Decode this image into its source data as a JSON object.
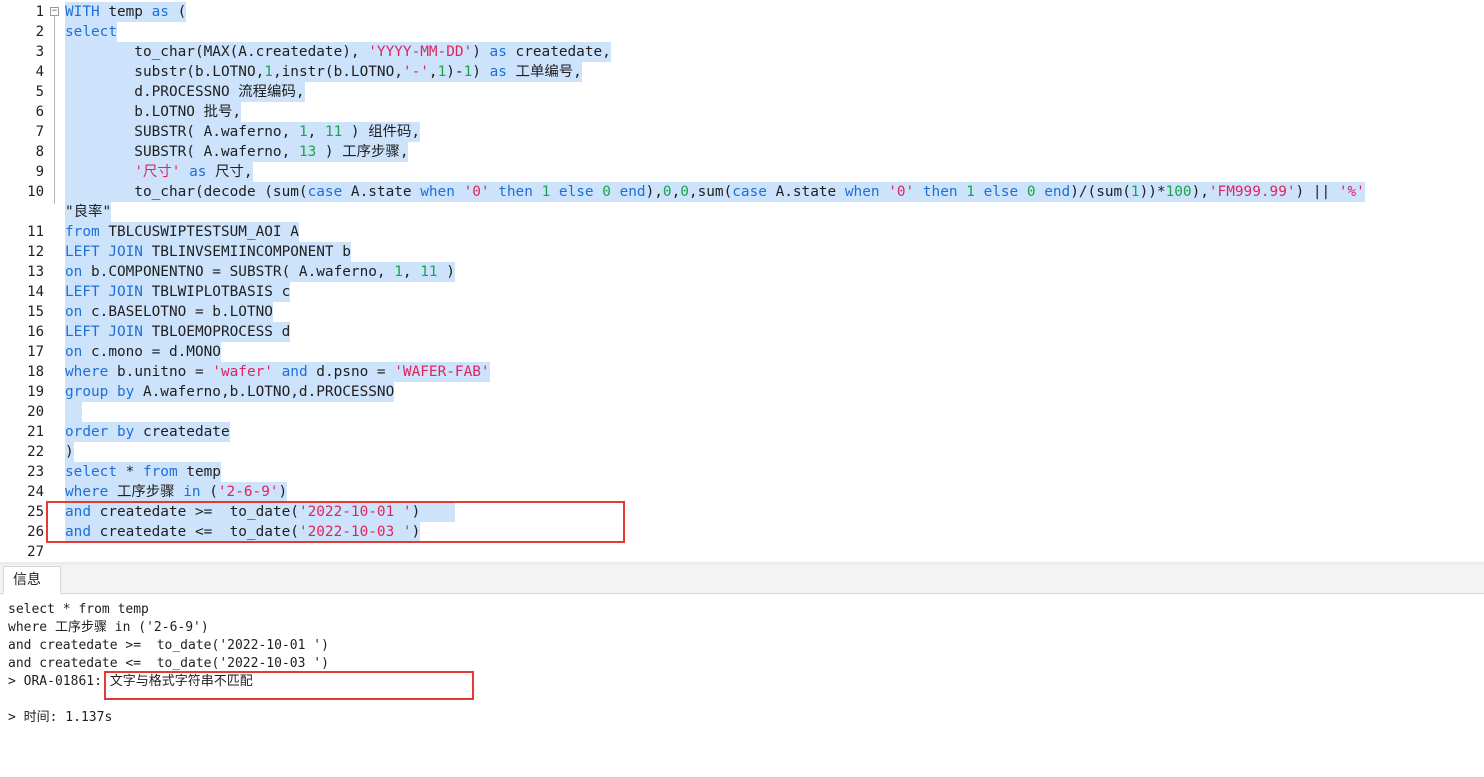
{
  "editor": {
    "lines": [
      {
        "no": "1",
        "parts": [
          [
            "kw",
            "WITH"
          ],
          [
            "t",
            " temp "
          ],
          [
            "kw",
            "as"
          ],
          [
            "t",
            " ("
          ]
        ]
      },
      {
        "no": "2",
        "parts": [
          [
            "kw",
            "select"
          ]
        ]
      },
      {
        "no": "3",
        "parts": [
          [
            "t",
            "        to_char(MAX(A.createdate), "
          ],
          [
            "str",
            "'YYYY-MM-DD'"
          ],
          [
            "t",
            ") "
          ],
          [
            "kw",
            "as"
          ],
          [
            "t",
            " createdate,"
          ]
        ]
      },
      {
        "no": "4",
        "parts": [
          [
            "t",
            "        substr(b.LOTNO,"
          ],
          [
            "num",
            "1"
          ],
          [
            "t",
            ",instr(b.LOTNO,"
          ],
          [
            "str",
            "'-'"
          ],
          [
            "t",
            ","
          ],
          [
            "num",
            "1"
          ],
          [
            "t",
            ")-"
          ],
          [
            "num",
            "1"
          ],
          [
            "t",
            ") "
          ],
          [
            "kw",
            "as"
          ],
          [
            "t",
            " 工单编号,"
          ]
        ]
      },
      {
        "no": "5",
        "parts": [
          [
            "t",
            "        d.PROCESSNO 流程编码,"
          ]
        ]
      },
      {
        "no": "6",
        "parts": [
          [
            "t",
            "        b.LOTNO 批号,"
          ]
        ]
      },
      {
        "no": "7",
        "parts": [
          [
            "t",
            "        SUBSTR( A.waferno, "
          ],
          [
            "num",
            "1"
          ],
          [
            "t",
            ", "
          ],
          [
            "num",
            "11"
          ],
          [
            "t",
            " ) 组件码,"
          ]
        ]
      },
      {
        "no": "8",
        "parts": [
          [
            "t",
            "        SUBSTR( A.waferno, "
          ],
          [
            "num",
            "13"
          ],
          [
            "t",
            " ) 工序步骤,"
          ]
        ]
      },
      {
        "no": "9",
        "parts": [
          [
            "t",
            "        "
          ],
          [
            "str",
            "'尺寸'"
          ],
          [
            "t",
            " "
          ],
          [
            "kw",
            "as"
          ],
          [
            "t",
            " 尺寸,"
          ]
        ]
      },
      {
        "no": "10",
        "parts": [
          [
            "t",
            "        to_char(decode (sum("
          ],
          [
            "kw",
            "case"
          ],
          [
            "t",
            " A.state "
          ],
          [
            "kw",
            "when"
          ],
          [
            "t",
            " "
          ],
          [
            "str",
            "'0'"
          ],
          [
            "t",
            " "
          ],
          [
            "kw",
            "then"
          ],
          [
            "t",
            " "
          ],
          [
            "num",
            "1"
          ],
          [
            "t",
            " "
          ],
          [
            "kw",
            "else"
          ],
          [
            "t",
            " "
          ],
          [
            "num",
            "0"
          ],
          [
            "t",
            " "
          ],
          [
            "kw",
            "end"
          ],
          [
            "t",
            "),"
          ],
          [
            "num",
            "0"
          ],
          [
            "t",
            ","
          ],
          [
            "num",
            "0"
          ],
          [
            "t",
            ",sum("
          ],
          [
            "kw",
            "case"
          ],
          [
            "t",
            " A.state "
          ],
          [
            "kw",
            "when"
          ],
          [
            "t",
            " "
          ],
          [
            "str",
            "'0'"
          ],
          [
            "t",
            " "
          ],
          [
            "kw",
            "then"
          ],
          [
            "t",
            " "
          ],
          [
            "num",
            "1"
          ],
          [
            "t",
            " "
          ],
          [
            "kw",
            "else"
          ],
          [
            "t",
            " "
          ],
          [
            "num",
            "0"
          ],
          [
            "t",
            " "
          ],
          [
            "kw",
            "end"
          ],
          [
            "t",
            ")/(sum("
          ],
          [
            "num",
            "1"
          ],
          [
            "t",
            "))*"
          ],
          [
            "num",
            "100"
          ],
          [
            "t",
            "),"
          ],
          [
            "str",
            "'FM999.99'"
          ],
          [
            "t",
            ") || "
          ],
          [
            "str",
            "'%'"
          ]
        ]
      },
      {
        "no": "",
        "parts": [
          [
            "t",
            "\"良率\""
          ]
        ]
      },
      {
        "no": "11",
        "parts": [
          [
            "kw",
            "from"
          ],
          [
            "t",
            " TBLCUSWIPTESTSUM_AOI A"
          ]
        ]
      },
      {
        "no": "12",
        "parts": [
          [
            "kw",
            "LEFT JOIN"
          ],
          [
            "t",
            " TBLINVSEMIINCOMPONENT b"
          ]
        ]
      },
      {
        "no": "13",
        "parts": [
          [
            "kw",
            "on"
          ],
          [
            "t",
            " b.COMPONENTNO = SUBSTR( A.waferno, "
          ],
          [
            "num",
            "1"
          ],
          [
            "t",
            ", "
          ],
          [
            "num",
            "11"
          ],
          [
            "t",
            " )"
          ]
        ]
      },
      {
        "no": "14",
        "parts": [
          [
            "kw",
            "LEFT JOIN"
          ],
          [
            "t",
            " TBLWIPLOTBASIS c"
          ]
        ]
      },
      {
        "no": "15",
        "parts": [
          [
            "kw",
            "on"
          ],
          [
            "t",
            " c.BASELOTNO = b.LOTNO"
          ]
        ]
      },
      {
        "no": "16",
        "parts": [
          [
            "kw",
            "LEFT JOIN"
          ],
          [
            "t",
            " TBLOEMOPROCESS d"
          ]
        ]
      },
      {
        "no": "17",
        "parts": [
          [
            "kw",
            "on"
          ],
          [
            "t",
            " c.mono = d.MONO"
          ]
        ]
      },
      {
        "no": "18",
        "parts": [
          [
            "kw",
            "where"
          ],
          [
            "t",
            " b.unitno = "
          ],
          [
            "str",
            "'wafer'"
          ],
          [
            "t",
            " "
          ],
          [
            "kw",
            "and"
          ],
          [
            "t",
            " d.psno = "
          ],
          [
            "str",
            "'WAFER-FAB'"
          ]
        ]
      },
      {
        "no": "19",
        "parts": [
          [
            "kw",
            "group by"
          ],
          [
            "t",
            " A.waferno,b.LOTNO,d.PROCESSNO"
          ]
        ]
      },
      {
        "no": "20",
        "parts": [
          [
            "t",
            "  "
          ]
        ]
      },
      {
        "no": "21",
        "parts": [
          [
            "kw",
            "order by"
          ],
          [
            "t",
            " createdate"
          ]
        ]
      },
      {
        "no": "22",
        "parts": [
          [
            "t",
            ")"
          ]
        ]
      },
      {
        "no": "23",
        "parts": [
          [
            "kw",
            "select"
          ],
          [
            "t",
            " * "
          ],
          [
            "kw",
            "from"
          ],
          [
            "t",
            " temp"
          ]
        ]
      },
      {
        "no": "24",
        "parts": [
          [
            "kw",
            "where"
          ],
          [
            "t",
            " 工序步骤 "
          ],
          [
            "kw",
            "in"
          ],
          [
            "t",
            " ("
          ],
          [
            "str",
            "'2-6-9'"
          ],
          [
            "t",
            ")"
          ]
        ]
      },
      {
        "no": "25",
        "parts": [
          [
            "kw",
            "and"
          ],
          [
            "t",
            " createdate >=  to_date("
          ],
          [
            "str",
            "'2022-10-01 '"
          ],
          [
            "t",
            ")    "
          ]
        ]
      },
      {
        "no": "26",
        "parts": [
          [
            "kw",
            "and"
          ],
          [
            "t",
            " createdate <=  to_date("
          ],
          [
            "str",
            "'2022-10-03 '"
          ],
          [
            "t",
            ")"
          ]
        ]
      },
      {
        "no": "27",
        "parts": []
      }
    ]
  },
  "tabs": {
    "info_label": "信息"
  },
  "output": {
    "lines": [
      "select * from temp",
      "where 工序步骤 in ('2-6-9')",
      "and createdate >=  to_date('2022-10-01 ')",
      "and createdate <=  to_date('2022-10-03 ')",
      "> ORA-01861: 文字与格式字符串不匹配",
      "",
      "> 时间: 1.137s"
    ]
  },
  "colors": {
    "keyword": "#1f6fd6",
    "string": "#e0245e",
    "number": "#1aa34a",
    "selection": "#cce3fb",
    "highlight_box": "#e53935"
  }
}
